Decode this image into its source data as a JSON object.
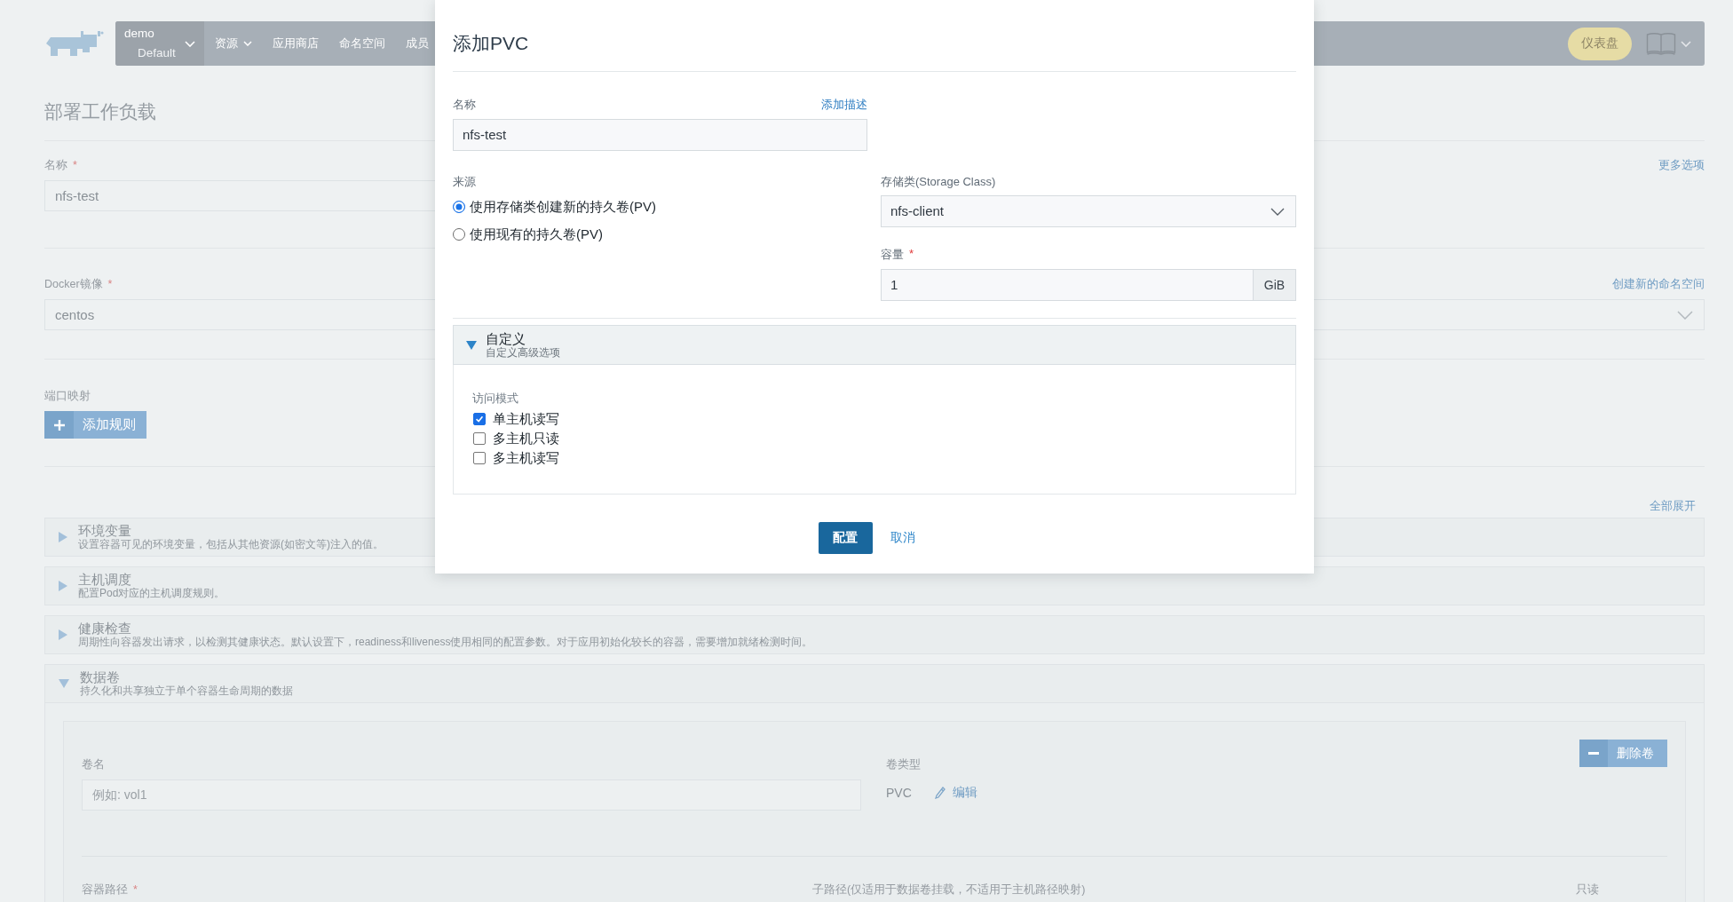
{
  "header": {
    "project": {
      "name": "demo",
      "cluster": "Default"
    },
    "nav": [
      {
        "label": "资源",
        "dropdown": true
      },
      {
        "label": "应用商店",
        "dropdown": false
      },
      {
        "label": "命名空间",
        "dropdown": false
      },
      {
        "label": "成员",
        "dropdown": false
      }
    ],
    "dashboard": "仪表盘"
  },
  "page": {
    "title": "部署工作负载",
    "name_field": {
      "label": "名称",
      "required_mark": "*",
      "value": "nfs-test"
    },
    "more_options": "更多选项",
    "image_field": {
      "label": "Docker镜像",
      "required_mark": "*",
      "value": "centos"
    },
    "namespace_link": "创建新的命名空间",
    "port_mapping": {
      "label": "端口映射",
      "button": "添加规则"
    },
    "expand_all": "全部展开",
    "sections": [
      {
        "title": "环境变量",
        "description": "设置容器可见的环境变量，包括从其他资源(如密文等)注入的值。",
        "expanded": false
      },
      {
        "title": "主机调度",
        "description": "配置Pod对应的主机调度规则。",
        "expanded": false
      },
      {
        "title": "健康检查",
        "description": "周期性向容器发出请求，以检测其健康状态。默认设置下，readiness和liveness使用相同的配置参数。对于应用初始化较长的容器，需要增加就绪检测时间。",
        "expanded": false
      },
      {
        "title": "数据卷",
        "description": "持久化和共享独立于单个容器生命周期的数据",
        "expanded": true,
        "volume": {
          "name_label": "卷名",
          "name_placeholder": "例如: vol1",
          "type_label": "卷类型",
          "type_value": "PVC",
          "edit": "编辑",
          "remove": "删除卷",
          "mount_columns": [
            {
              "label": "容器路径",
              "required_mark": "*"
            },
            {
              "label": "子路径(仅适用于数据卷挂载，不适用于主机路径映射)"
            },
            {
              "label": "只读"
            }
          ]
        }
      }
    ]
  },
  "dialog": {
    "title": "添加PVC",
    "name": {
      "label": "名称",
      "value": "nfs-test",
      "add_description": "添加描述"
    },
    "source": {
      "label": "来源",
      "options": [
        {
          "label": "使用存储类创建新的持久卷(PV)",
          "selected": true
        },
        {
          "label": "使用现有的持久卷(PV)",
          "selected": false
        }
      ]
    },
    "storage_class": {
      "label": "存储类(Storage Class)",
      "value": "nfs-client"
    },
    "capacity": {
      "label": "容量",
      "required_mark": "*",
      "value": "1",
      "unit": "GiB"
    },
    "customize": {
      "title": "自定义",
      "subtitle": "自定义高级选项",
      "expanded": true,
      "access_mode": {
        "label": "访问模式",
        "options": [
          {
            "label": "单主机读写",
            "checked": true
          },
          {
            "label": "多主机只读",
            "checked": false
          },
          {
            "label": "多主机读写",
            "checked": false
          }
        ]
      }
    },
    "buttons": {
      "confirm": "配置",
      "cancel": "取消"
    }
  }
}
